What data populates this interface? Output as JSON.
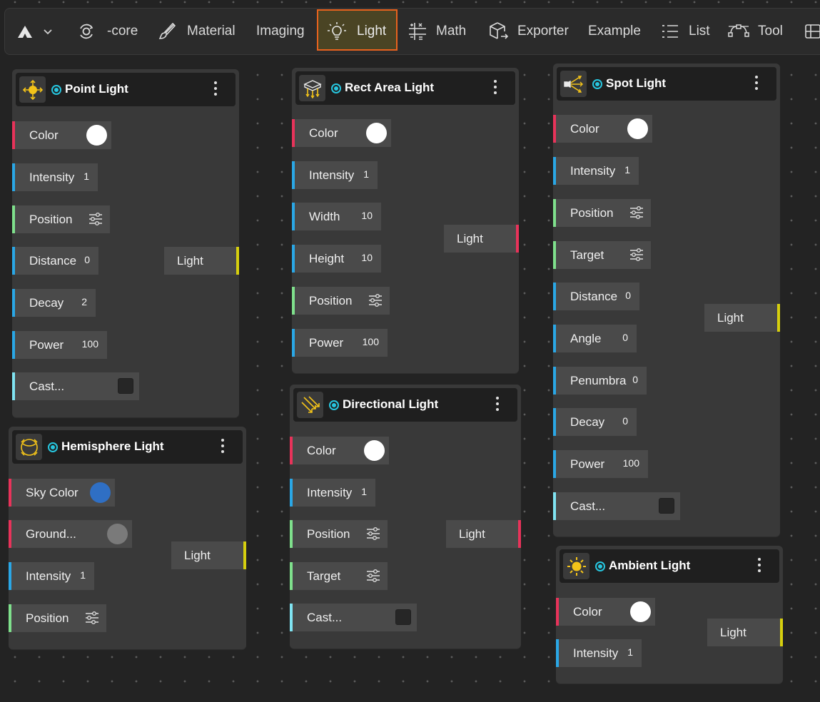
{
  "toolbar": {
    "core_label": "-core",
    "material_label": "Material",
    "imaging_label": "Imaging",
    "light_label": "Light",
    "math_label": "Math",
    "exporter_label": "Exporter",
    "example_label": "Example",
    "list_label": "List",
    "tool_label": "Tool"
  },
  "colors": {
    "red_port": "#e8335a",
    "blue_port": "#2aa7e6",
    "green_port": "#7fe08c",
    "cyan_port": "#80e4f2",
    "light_output_yellow": "#d6cf0e",
    "active_tab_border": "#e8621e",
    "status_dot": "#27c7e0",
    "sky_color": "#2f6fc4",
    "ground_color": "#7a7a7a",
    "white_color": "#ffffff"
  },
  "nodes": {
    "point": {
      "title": "Point Light",
      "color": "Color",
      "intensity": "Intensity",
      "intensity_val": "1",
      "position": "Position",
      "distance": "Distance",
      "distance_val": "0",
      "decay": "Decay",
      "decay_val": "2",
      "power": "Power",
      "power_val": "100",
      "cast": "Cast...",
      "output": "Light"
    },
    "hemisphere": {
      "title": "Hemisphere Light",
      "sky": "Sky Color",
      "ground": "Ground...",
      "intensity": "Intensity",
      "intensity_val": "1",
      "position": "Position",
      "output": "Light"
    },
    "rect": {
      "title": "Rect Area Light",
      "color": "Color",
      "intensity": "Intensity",
      "intensity_val": "1",
      "width": "Width",
      "width_val": "10",
      "height": "Height",
      "height_val": "10",
      "position": "Position",
      "power": "Power",
      "power_val": "100",
      "output": "Light"
    },
    "directional": {
      "title": "Directional Light",
      "color": "Color",
      "intensity": "Intensity",
      "intensity_val": "1",
      "position": "Position",
      "target": "Target",
      "cast": "Cast...",
      "output": "Light"
    },
    "spot": {
      "title": "Spot Light",
      "color": "Color",
      "intensity": "Intensity",
      "intensity_val": "1",
      "position": "Position",
      "target": "Target",
      "distance": "Distance",
      "distance_val": "0",
      "angle": "Angle",
      "angle_val": "0",
      "penumbra": "Penumbra",
      "penumbra_val": "0",
      "decay": "Decay",
      "decay_val": "0",
      "power": "Power",
      "power_val": "100",
      "cast": "Cast...",
      "output": "Light"
    },
    "ambient": {
      "title": "Ambient Light",
      "color": "Color",
      "intensity": "Intensity",
      "intensity_val": "1",
      "output": "Light"
    }
  }
}
